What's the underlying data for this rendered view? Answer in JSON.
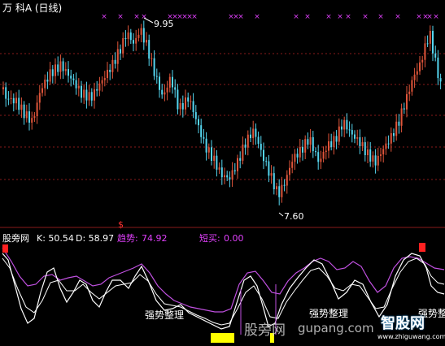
{
  "header": {
    "title": "万  科A (日线)"
  },
  "price_panel": {
    "high_label": "9.95",
    "low_label": "7.60",
    "marker_glyph": "×"
  },
  "indicator": {
    "source_label": "股旁网",
    "k_label": "K: 50.54",
    "d_label": "D: 58.97",
    "trend_label": "趋势:",
    "trend_value": "74.92",
    "short_buy_label": "短买:",
    "short_buy_value": "0.00",
    "dollar_glyph": "$",
    "annotations": [
      "强势整理",
      "强势整理",
      "强势整"
    ]
  },
  "watermarks": {
    "left": "股旁网",
    "center": "gupang.com",
    "brand": "智股网",
    "brand_url": "www.zhiguwang.com"
  },
  "colors": {
    "up": "#e0553a",
    "down": "#55d6f0",
    "marker": "#e040fb",
    "k_line": "#ffffff",
    "d_line": "#ffffff",
    "trend_line": "#c050e0",
    "signal_red": "#ff2020",
    "signal_yellow": "#ffff00",
    "grid": "#8a1a1a"
  },
  "chart_data": {
    "type": "candlestick",
    "price_labels": {
      "high": 9.95,
      "low": 7.6
    },
    "indicator_values": {
      "K": 50.54,
      "D": 58.97,
      "trend": 74.92,
      "short_buy": 0.0
    }
  }
}
